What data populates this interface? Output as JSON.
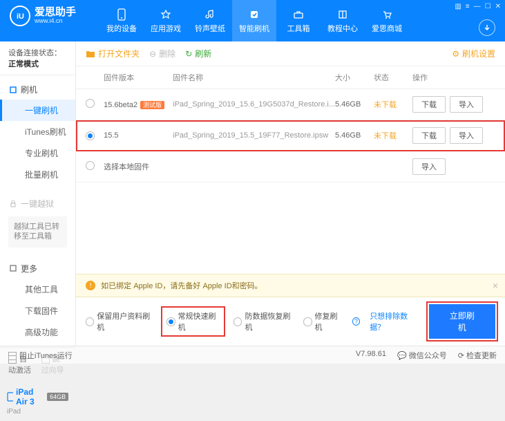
{
  "app": {
    "name": "爱思助手",
    "url": "www.i4.cn"
  },
  "nav": [
    {
      "label": "我的设备"
    },
    {
      "label": "应用游戏"
    },
    {
      "label": "铃声壁纸"
    },
    {
      "label": "智能刷机"
    },
    {
      "label": "工具箱"
    },
    {
      "label": "教程中心"
    },
    {
      "label": "爱思商城"
    }
  ],
  "sidebar": {
    "conn_label": "设备连接状态：",
    "conn_value": "正常模式",
    "g1": {
      "head": "刷机",
      "items": [
        "一键刷机",
        "iTunes刷机",
        "专业刷机",
        "批量刷机"
      ]
    },
    "g2": {
      "head": "一键越狱",
      "note": "越狱工具已转移至工具箱"
    },
    "g3": {
      "head": "更多",
      "items": [
        "其他工具",
        "下载固件",
        "高级功能"
      ]
    },
    "foot": {
      "auto": "自动激活",
      "skip": "跳过向导"
    },
    "device": {
      "name": "iPad Air 3",
      "badge": "64GB",
      "sub": "iPad"
    }
  },
  "toolbar": {
    "open": "打开文件夹",
    "del": "删除",
    "refresh": "刷新",
    "settings": "刷机设置"
  },
  "table": {
    "headers": {
      "ver": "固件版本",
      "name": "固件名称",
      "size": "大小",
      "state": "状态",
      "ops": "操作"
    },
    "rows": [
      {
        "ver": "15.6beta2",
        "tag": "测试版",
        "name": "iPad_Spring_2019_15.6_19G5037d_Restore.i...",
        "size": "5.46GB",
        "state": "未下载"
      },
      {
        "ver": "15.5",
        "name": "iPad_Spring_2019_15.5_19F77_Restore.ipsw",
        "size": "5.46GB",
        "state": "未下载"
      }
    ],
    "local": "选择本地固件",
    "btn_dl": "下载",
    "btn_imp": "导入"
  },
  "warning": "如已绑定 Apple ID，请先备好 Apple ID和密码。",
  "options": {
    "keep": "保留用户资料刷机",
    "normal": "常规快速刷机",
    "anti": "防数据恢复刷机",
    "repair": "修复刷机",
    "exclude": "只想排除数据？",
    "flash": "立即刷机"
  },
  "status": {
    "block": "阻止iTunes运行",
    "ver": "V7.98.61",
    "wechat": "微信公众号",
    "update": "检查更新"
  }
}
